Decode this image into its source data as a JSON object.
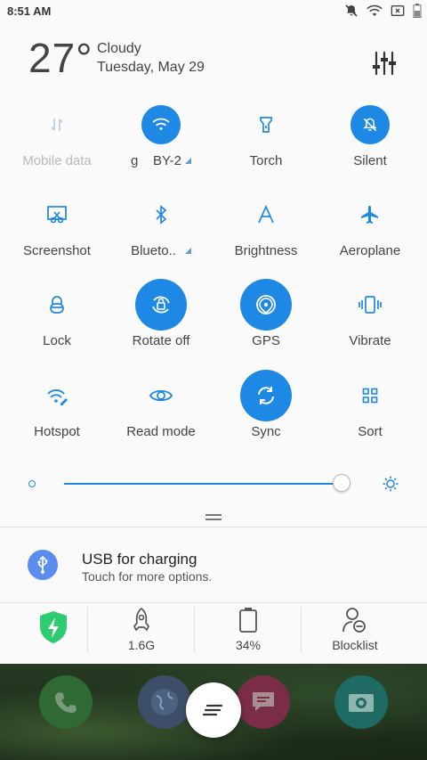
{
  "status_bar": {
    "time": "8:51 AM"
  },
  "weather": {
    "temperature": "27°",
    "condition": "Cloudy",
    "date": "Tuesday, May 29"
  },
  "tiles": [
    {
      "label": "Mobile data",
      "icon": "mobile-data-icon",
      "state": "off-dim"
    },
    {
      "label": "g    BY-2",
      "icon": "wifi-icon",
      "state": "on"
    },
    {
      "label": "Torch",
      "icon": "torch-icon",
      "state": "off"
    },
    {
      "label": "Silent",
      "icon": "silent-bell-icon",
      "state": "on"
    },
    {
      "label": "Screenshot",
      "icon": "screenshot-icon",
      "state": "off"
    },
    {
      "label": "Blueto..",
      "icon": "bluetooth-icon",
      "state": "off"
    },
    {
      "label": "Brightness",
      "icon": "brightness-a-icon",
      "state": "off"
    },
    {
      "label": "Aeroplane",
      "icon": "aeroplane-icon",
      "state": "off"
    },
    {
      "label": "Lock",
      "icon": "lock-icon",
      "state": "off"
    },
    {
      "label": "Rotate off",
      "icon": "rotate-lock-icon",
      "state": "on"
    },
    {
      "label": "GPS",
      "icon": "gps-icon",
      "state": "on"
    },
    {
      "label": "Vibrate",
      "icon": "vibrate-icon",
      "state": "off"
    },
    {
      "label": "Hotspot",
      "icon": "hotspot-icon",
      "state": "off"
    },
    {
      "label": "Read mode",
      "icon": "eye-icon",
      "state": "off"
    },
    {
      "label": "Sync",
      "icon": "sync-icon",
      "state": "on"
    },
    {
      "label": "Sort",
      "icon": "grid-icon",
      "state": "off"
    }
  ],
  "brightness": {
    "level": 0.98
  },
  "notification": {
    "title": "USB for charging",
    "subtitle": "Touch for more options."
  },
  "bottom_bar": [
    {
      "label": "",
      "icon": "shield-icon"
    },
    {
      "label": "1.6G",
      "icon": "rocket-icon"
    },
    {
      "label": "34%",
      "icon": "battery-icon"
    },
    {
      "label": "Blocklist",
      "icon": "blocklist-user-icon"
    }
  ],
  "colors": {
    "accent": "#1e88e5",
    "background": "#fafafa",
    "shield": "#2ecc71"
  }
}
